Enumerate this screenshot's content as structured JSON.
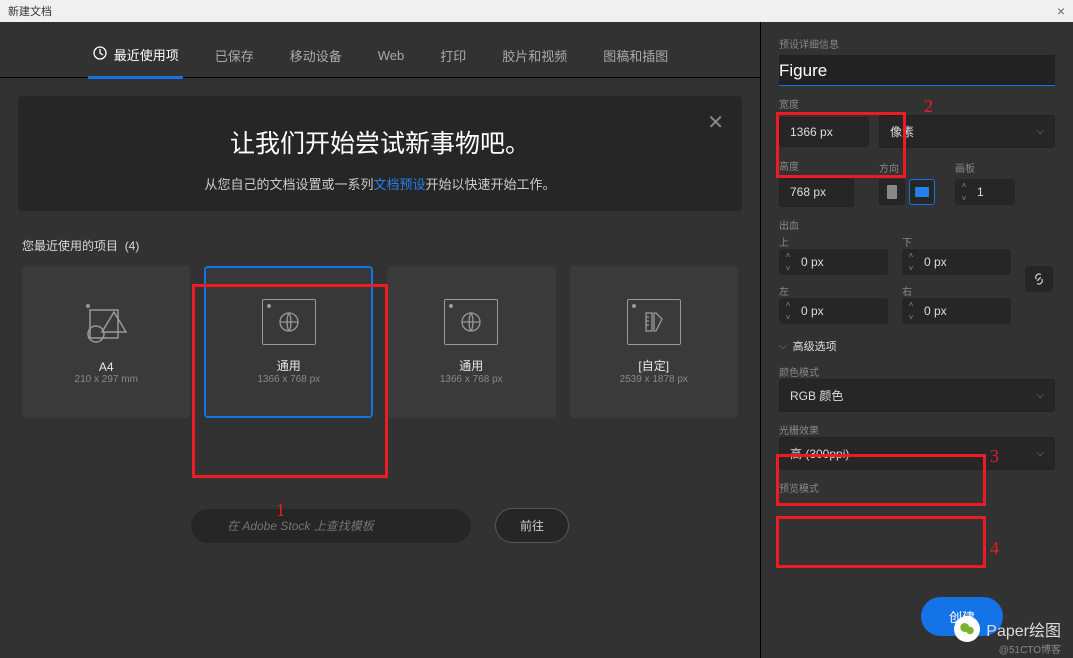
{
  "dialog": {
    "title": "新建文档",
    "close_glyph": "×"
  },
  "tabs": [
    {
      "key": "recent",
      "label": "最近使用项",
      "active": true,
      "icon": "clock-icon"
    },
    {
      "key": "saved",
      "label": "已保存"
    },
    {
      "key": "mobile",
      "label": "移动设备"
    },
    {
      "key": "web",
      "label": "Web"
    },
    {
      "key": "print",
      "label": "打印"
    },
    {
      "key": "film",
      "label": "胶片和视频"
    },
    {
      "key": "art",
      "label": "图稿和插图"
    }
  ],
  "intro": {
    "title": "让我们开始尝试新事物吧。",
    "sub_pre": "从您自己的文档设置或一系列",
    "sub_link": "文档预设",
    "sub_post": "开始以快速开始工作。"
  },
  "recent": {
    "header_text": "您最近使用的项目",
    "count": "(4)"
  },
  "presets": [
    {
      "name": "A4",
      "dim": "210 x 297 mm",
      "icon": "shapes"
    },
    {
      "name": "通用",
      "dim": "1366 x 768 px",
      "icon": "globe",
      "selected": true
    },
    {
      "name": "通用",
      "dim": "1366 x 768 px",
      "icon": "globe"
    },
    {
      "name": "[自定]",
      "dim": "2539 x 1878 px",
      "icon": "ruler"
    }
  ],
  "search": {
    "placeholder": "在 Adobe Stock 上查找模板",
    "go": "前往"
  },
  "details": {
    "header": "预设详细信息",
    "name_value": "Figure",
    "width_label": "宽度",
    "width_value": "1366 px",
    "unit": "像素",
    "height_label": "高度",
    "height_value": "768 px",
    "orient_label": "方向",
    "artboard_label": "画板",
    "artboard_value": "1",
    "bleed_label": "出血",
    "top": "上",
    "bottom": "下",
    "left": "左",
    "right": "右",
    "bleed_val": "0 px",
    "advanced": "高级选项",
    "color_mode_label": "颜色模式",
    "color_mode_value": "RGB 颜色",
    "raster_label": "光栅效果",
    "raster_value": "高 (300ppi)",
    "preview_label": "预览模式"
  },
  "actions": {
    "create": "创建",
    "close": "关闭"
  },
  "watermark": {
    "text": "Paper绘图",
    "sub": "@51CTO博客"
  },
  "annotations": {
    "n1": "1",
    "n2": "2",
    "n3": "3",
    "n4": "4"
  }
}
